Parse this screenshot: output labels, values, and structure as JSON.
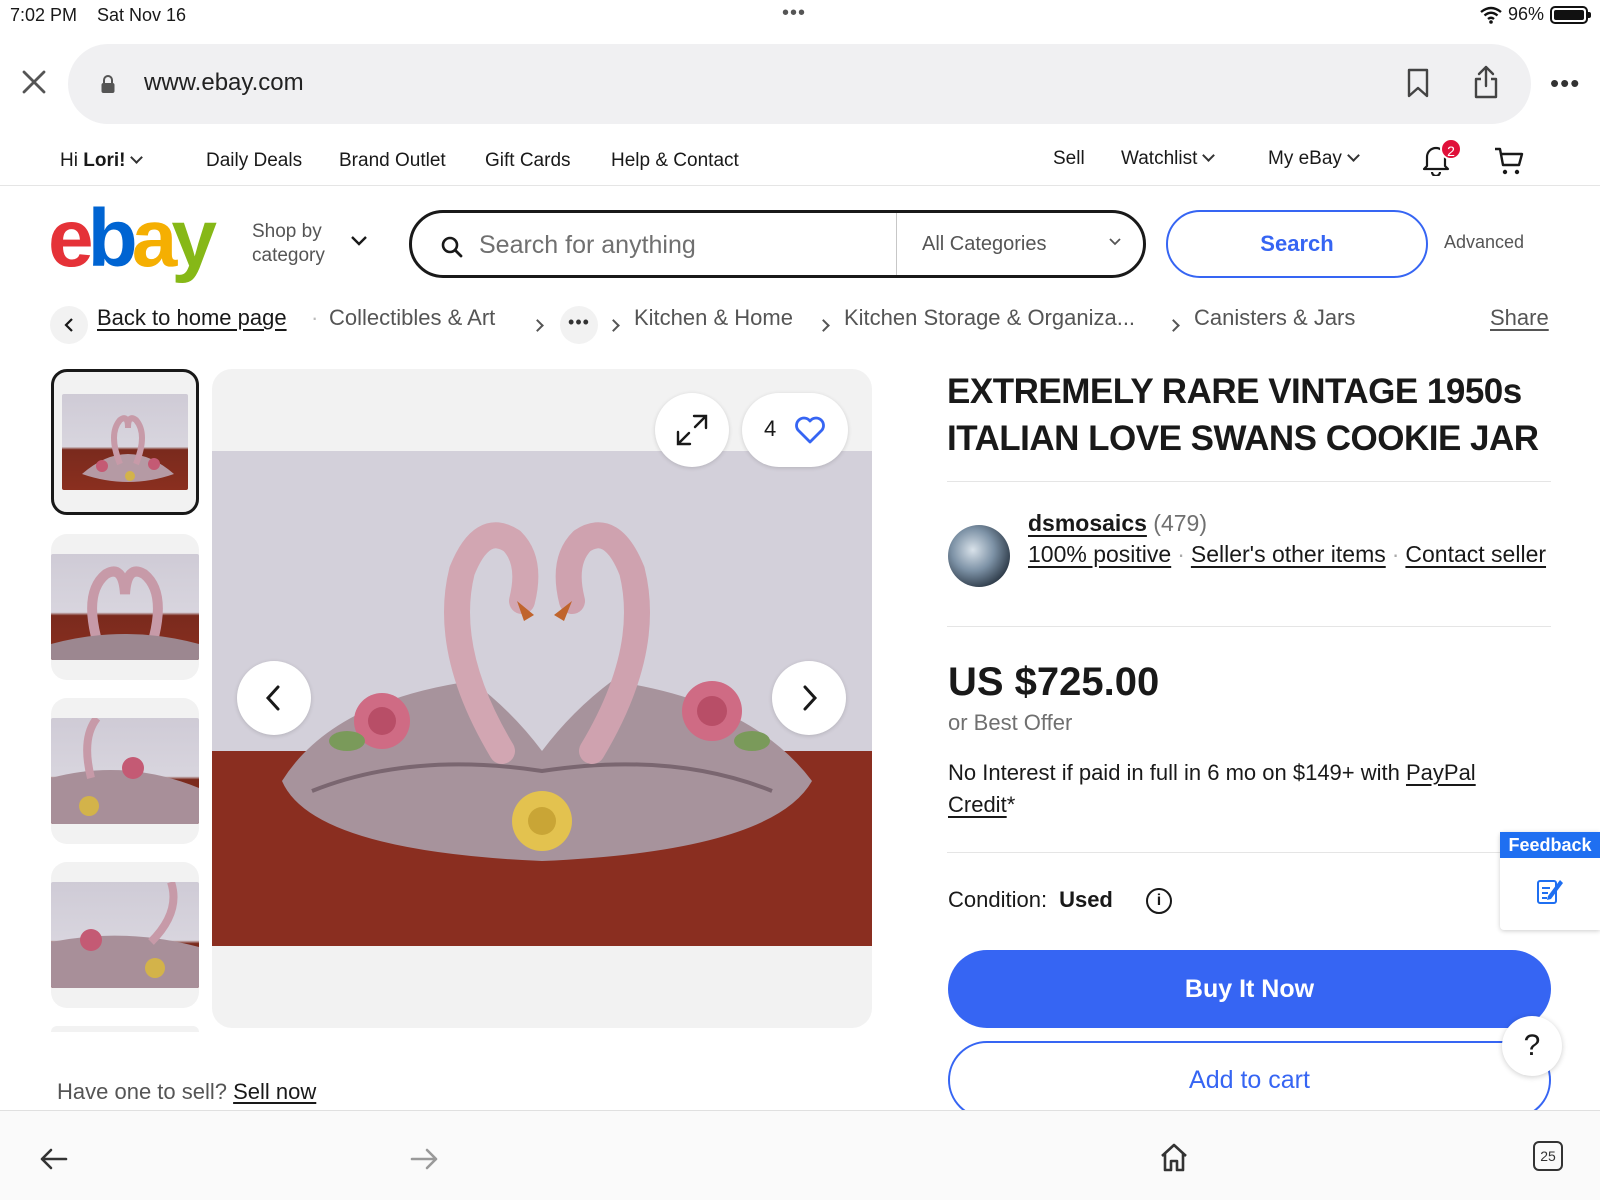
{
  "status_bar": {
    "time": "7:02 PM",
    "date": "Sat Nov 16",
    "battery": "96%"
  },
  "browser": {
    "url": "www.ebay.com",
    "tabs_count": "25"
  },
  "top_nav": {
    "greeting_prefix": "Hi ",
    "user": "Lori!",
    "links": [
      "Daily Deals",
      "Brand Outlet",
      "Gift Cards",
      "Help & Contact"
    ],
    "sell": "Sell",
    "watchlist": "Watchlist",
    "my_ebay": "My eBay",
    "notifications_count": "2"
  },
  "header": {
    "logo_letters": [
      "e",
      "b",
      "a",
      "y"
    ],
    "logo_colors": [
      "#e53238",
      "#0064d2",
      "#f5af02",
      "#86b817"
    ],
    "shop_by_line1": "Shop by",
    "shop_by_line2": "category",
    "search_placeholder": "Search for anything",
    "category_selected": "All Categories",
    "search_button": "Search",
    "advanced": "Advanced"
  },
  "breadcrumb": {
    "back": "Back to home page",
    "items": [
      "Collectibles & Art",
      "Kitchen & Home",
      "Kitchen Storage & Organiza...",
      "Canisters & Jars"
    ],
    "share": "Share"
  },
  "gallery": {
    "watchers": "4"
  },
  "listing": {
    "title": "EXTREMELY RARE VINTAGE 1950s ITALIAN LOVE SWANS COOKIE JAR",
    "seller_name": "dsmosaics",
    "seller_score": "(479)",
    "feedback": "100% positive",
    "other_items": "Seller's other items",
    "contact": "Contact seller",
    "price": "US $725.00",
    "best_offer": "or Best Offer",
    "no_interest_text": "No Interest if paid in full in 6 mo on $149+ with ",
    "paypal_credit": "PayPal Credit",
    "asterisk": "*",
    "condition_label": "Condition:",
    "condition_value": "Used",
    "buy_now": "Buy It Now",
    "add_to_cart": "Add to cart"
  },
  "sell_prompt": {
    "text": "Have one to sell?",
    "link": "Sell now"
  },
  "feedback_tab": {
    "label": "Feedback"
  },
  "colors": {
    "accent": "#3665f3",
    "badge": "#e0103a",
    "feedback": "#1f6ff1"
  }
}
